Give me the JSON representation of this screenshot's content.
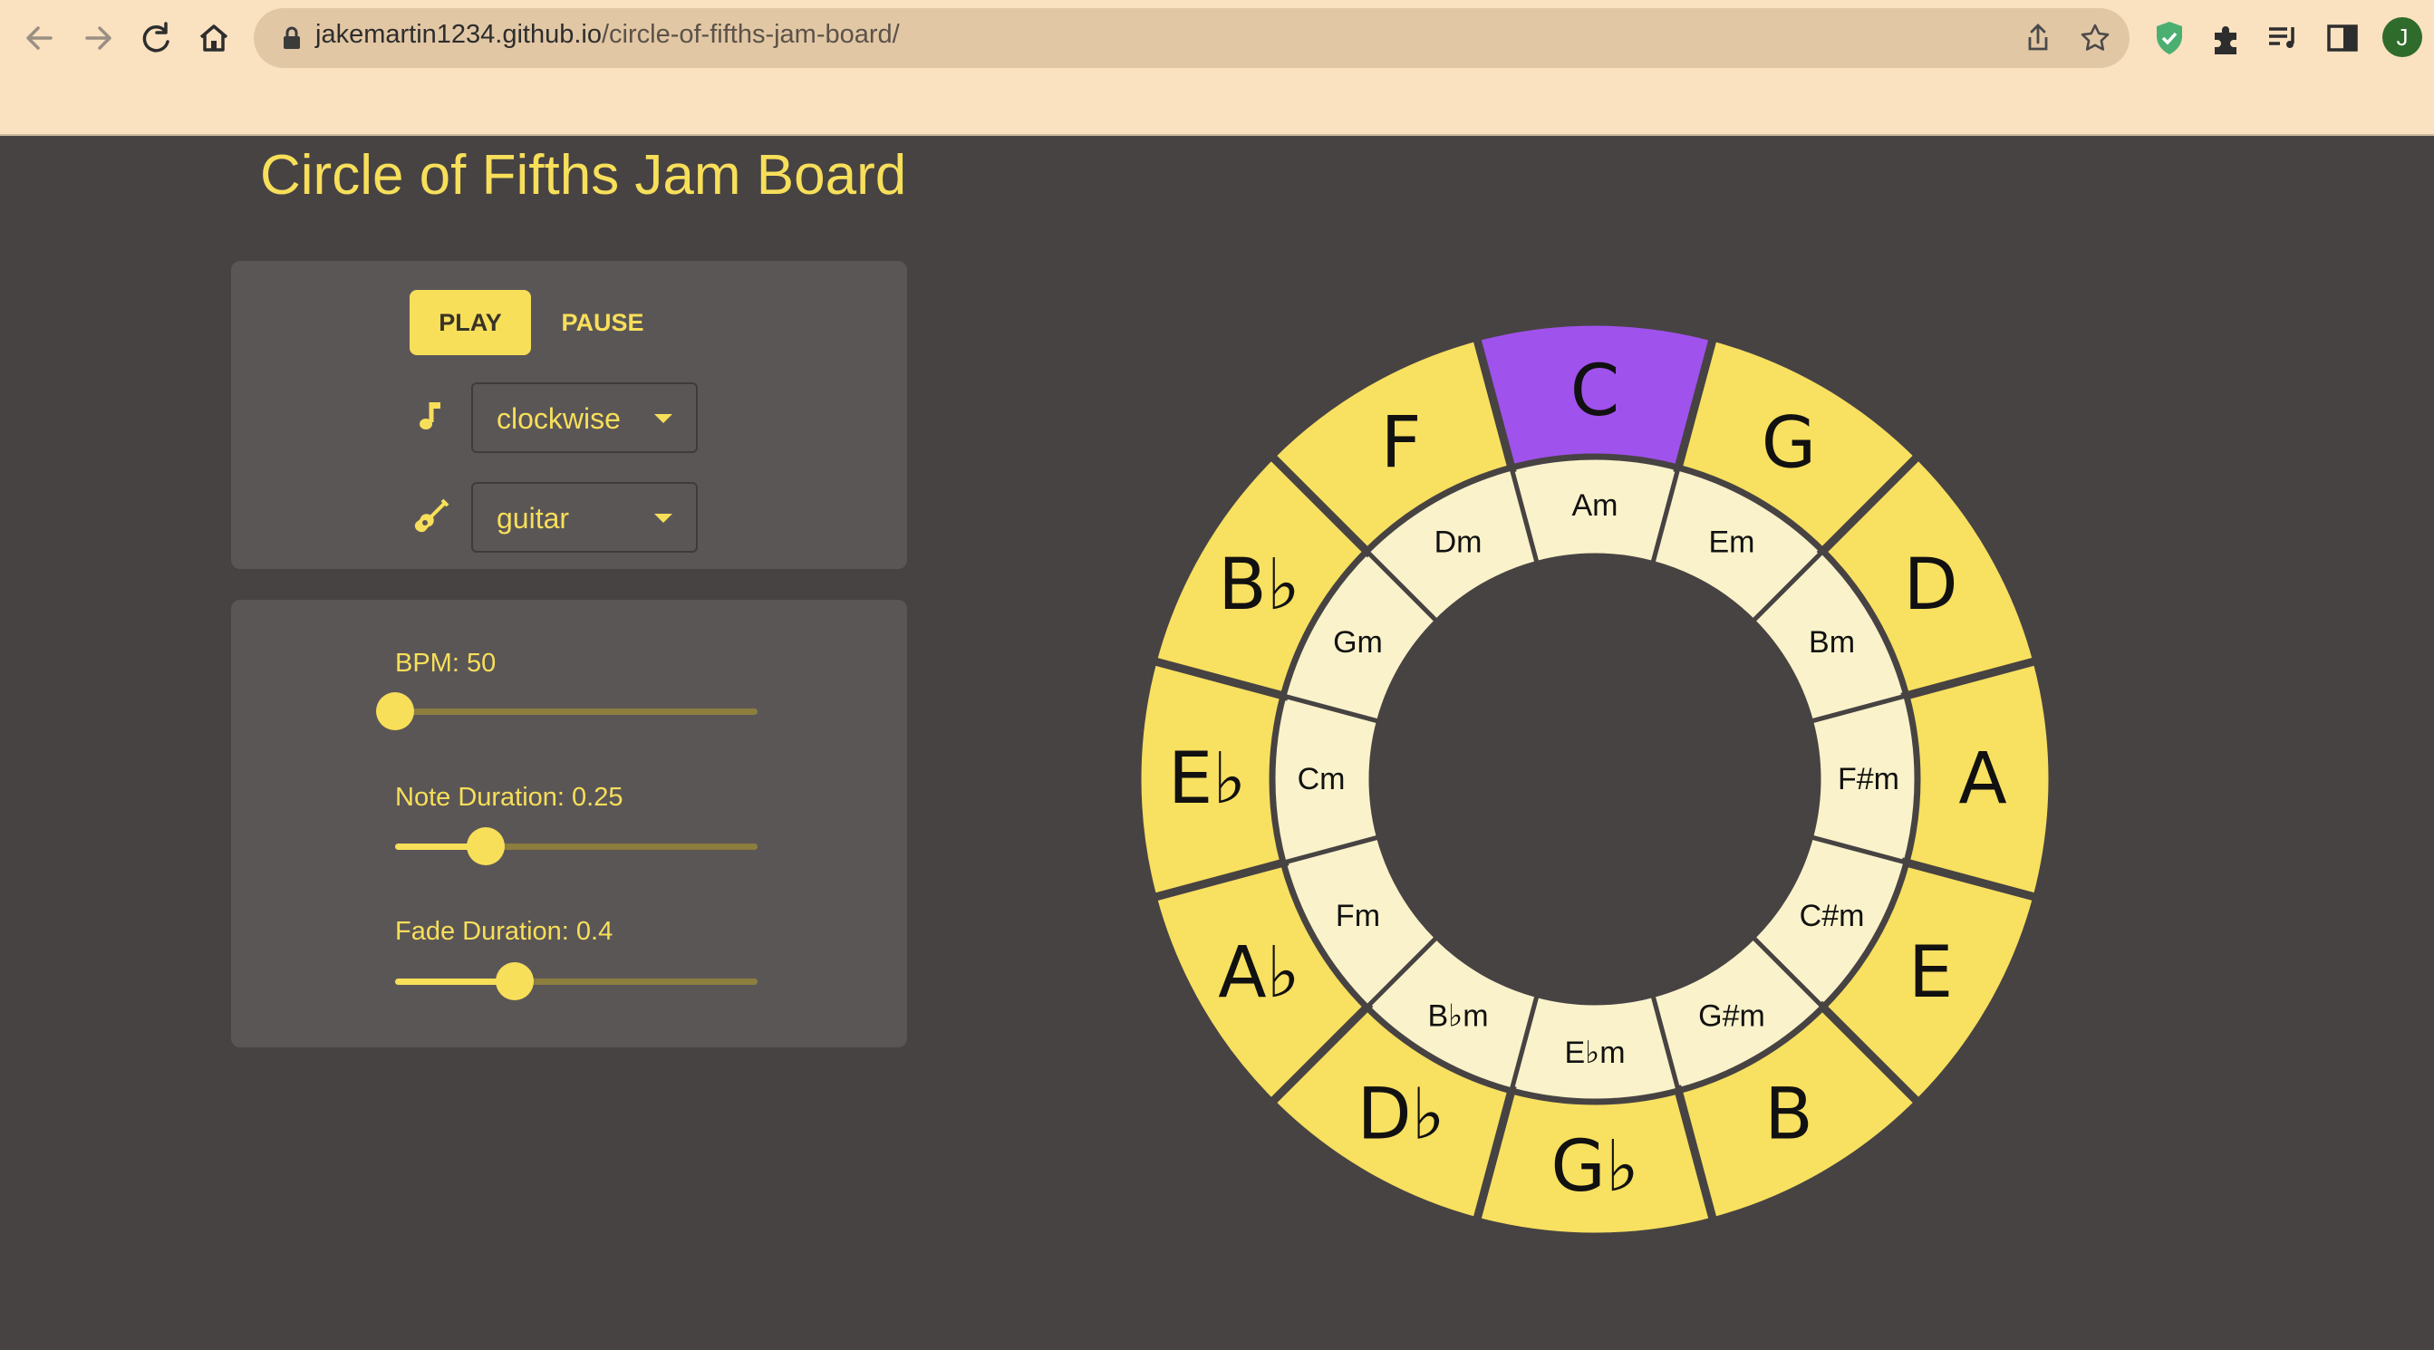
{
  "browser": {
    "url_host": "jakemartin1234.github.io",
    "url_path": "/circle-of-fifths-jam-board/",
    "profile_initial": "J",
    "icons": [
      "back-icon",
      "forward-icon",
      "reload-icon",
      "home-icon",
      "lock-icon",
      "share-icon",
      "star-icon",
      "shield-extension-icon",
      "puzzle-extensions-icon",
      "reading-list-icon",
      "side-panel-icon"
    ]
  },
  "page": {
    "title": "Circle of Fifths Jam Board"
  },
  "controls": {
    "play_label": "PLAY",
    "pause_label": "PAUSE",
    "direction_icon": "music-note-icon",
    "direction_value": "clockwise",
    "instrument_icon": "guitar-icon",
    "instrument_value": "guitar"
  },
  "sliders": [
    {
      "label": "BPM: 50",
      "value": 50,
      "fraction": 0.0
    },
    {
      "label": "Note Duration: 0.25",
      "value": 0.25,
      "fraction": 0.25
    },
    {
      "label": "Fade Duration: 0.4",
      "value": 0.4,
      "fraction": 0.33
    }
  ],
  "circle": {
    "major": [
      "C",
      "G",
      "D",
      "A",
      "E",
      "B",
      "G♭",
      "D♭",
      "A♭",
      "E♭",
      "B♭",
      "F"
    ],
    "minor": [
      "Am",
      "Em",
      "Bm",
      "F#m",
      "C#m",
      "G#m",
      "E♭m",
      "B♭m",
      "Fm",
      "Cm",
      "Gm",
      "Dm"
    ],
    "active_index": 0,
    "colors": {
      "major": "#f8e060",
      "minor": "#faf2ca",
      "active": "#a052ec",
      "border": "#474343",
      "text": "#111111"
    }
  },
  "colors": {
    "background": "#474343",
    "panel": "#5b5656",
    "accent": "#f7df5a",
    "chrome": "#fae1c0"
  }
}
